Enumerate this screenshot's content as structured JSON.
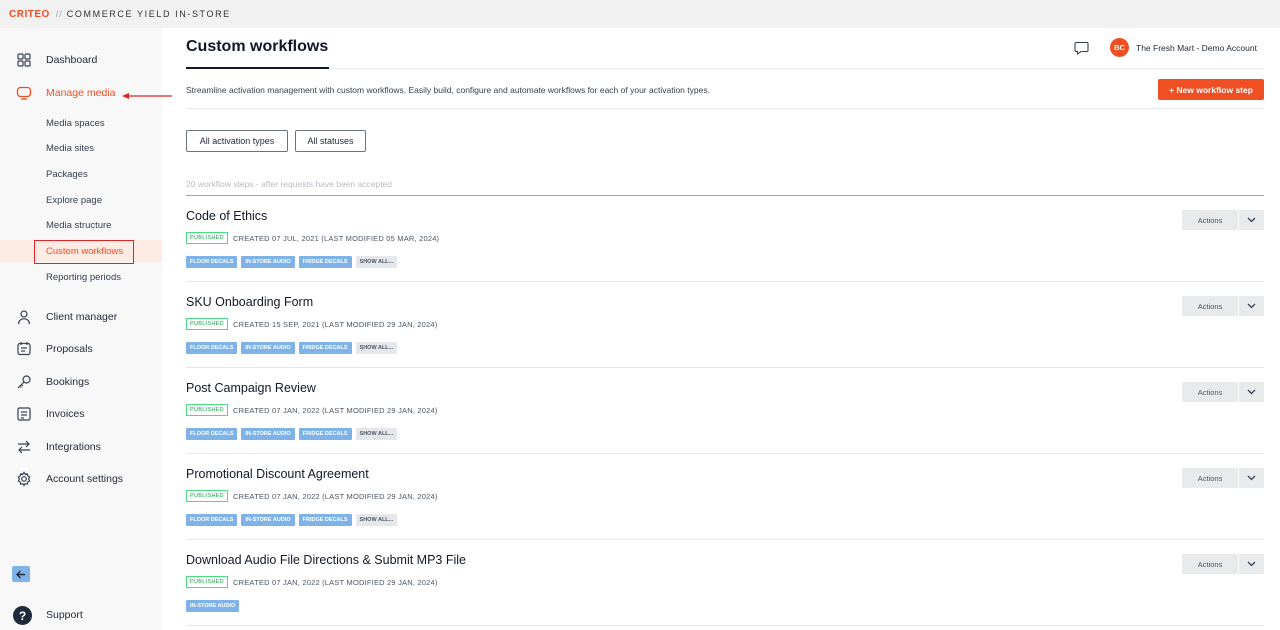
{
  "topbar": {
    "brand": "CRITEO",
    "separator": "//",
    "product": "COMMERCE YIELD IN-STORE"
  },
  "sidebar": {
    "items": [
      {
        "label": "Dashboard",
        "icon": "grid-icon"
      },
      {
        "label": "Manage media",
        "icon": "monitor-icon",
        "active": true
      },
      {
        "label": "Client manager",
        "icon": "user-icon"
      },
      {
        "label": "Proposals",
        "icon": "document-chat-icon"
      },
      {
        "label": "Bookings",
        "icon": "key-icon"
      },
      {
        "label": "Invoices",
        "icon": "invoice-icon"
      },
      {
        "label": "Integrations",
        "icon": "swap-arrows-icon"
      },
      {
        "label": "Account settings",
        "icon": "gear-icon"
      }
    ],
    "sub_items": [
      {
        "label": "Media spaces"
      },
      {
        "label": "Media sites"
      },
      {
        "label": "Packages"
      },
      {
        "label": "Explore page"
      },
      {
        "label": "Media structure"
      },
      {
        "label": "Custom workflows",
        "active": true
      },
      {
        "label": "Reporting periods"
      }
    ],
    "support_label": "Support",
    "support_glyph": "?"
  },
  "header": {
    "title": "Custom workflows",
    "avatar_initials": "BC",
    "account_name": "The Fresh Mart - Demo Account"
  },
  "main": {
    "description": "Streamline activation management with custom workflows. Easily build, configure and automate workflows for each of your activation types.",
    "new_button": "+ New workflow step",
    "filters": [
      "All activation types",
      "All statuses"
    ],
    "count_text": "20 workflow steps - after requests have been accepted",
    "actions_label": "Actions",
    "rows": [
      {
        "title": "Code of Ethics",
        "status": "PUBLISHED",
        "meta": "CREATED 07 JUL, 2021 (LAST MODIFIED 05 MAR, 2024)",
        "tags": [
          "FLOOR DECALS",
          "IN-STORE AUDIO",
          "FRIDGE DECALS"
        ],
        "more": "SHOW ALL..."
      },
      {
        "title": "SKU Onboarding Form",
        "status": "PUBLISHED",
        "meta": "CREATED 15 SEP, 2021 (LAST MODIFIED 29 JAN, 2024)",
        "tags": [
          "FLOOR DECALS",
          "IN-STORE AUDIO",
          "FRIDGE DECALS"
        ],
        "more": "SHOW ALL..."
      },
      {
        "title": "Post Campaign Review",
        "status": "PUBLISHED",
        "meta": "CREATED 07 JAN, 2022 (LAST MODIFIED 29 JAN, 2024)",
        "tags": [
          "FLOOR DECALS",
          "IN-STORE AUDIO",
          "FRIDGE DECALS"
        ],
        "more": "SHOW ALL..."
      },
      {
        "title": "Promotional Discount Agreement",
        "status": "PUBLISHED",
        "meta": "CREATED 07 JAN, 2022 (LAST MODIFIED 29 JAN, 2024)",
        "tags": [
          "FLOOR DECALS",
          "IN-STORE AUDIO",
          "FRIDGE DECALS"
        ],
        "more": "SHOW ALL..."
      },
      {
        "title": "Download Audio File Directions & Submit MP3 File",
        "status": "PUBLISHED",
        "meta": "CREATED 07 JAN, 2022 (LAST MODIFIED 29 JAN, 2024)",
        "tags": [
          "IN-STORE AUDIO"
        ],
        "more": ""
      }
    ]
  },
  "colors": {
    "accent": "#f04e23",
    "tag": "#7fb3e8",
    "published": "#16a34a",
    "highlight": "#dc2626"
  }
}
